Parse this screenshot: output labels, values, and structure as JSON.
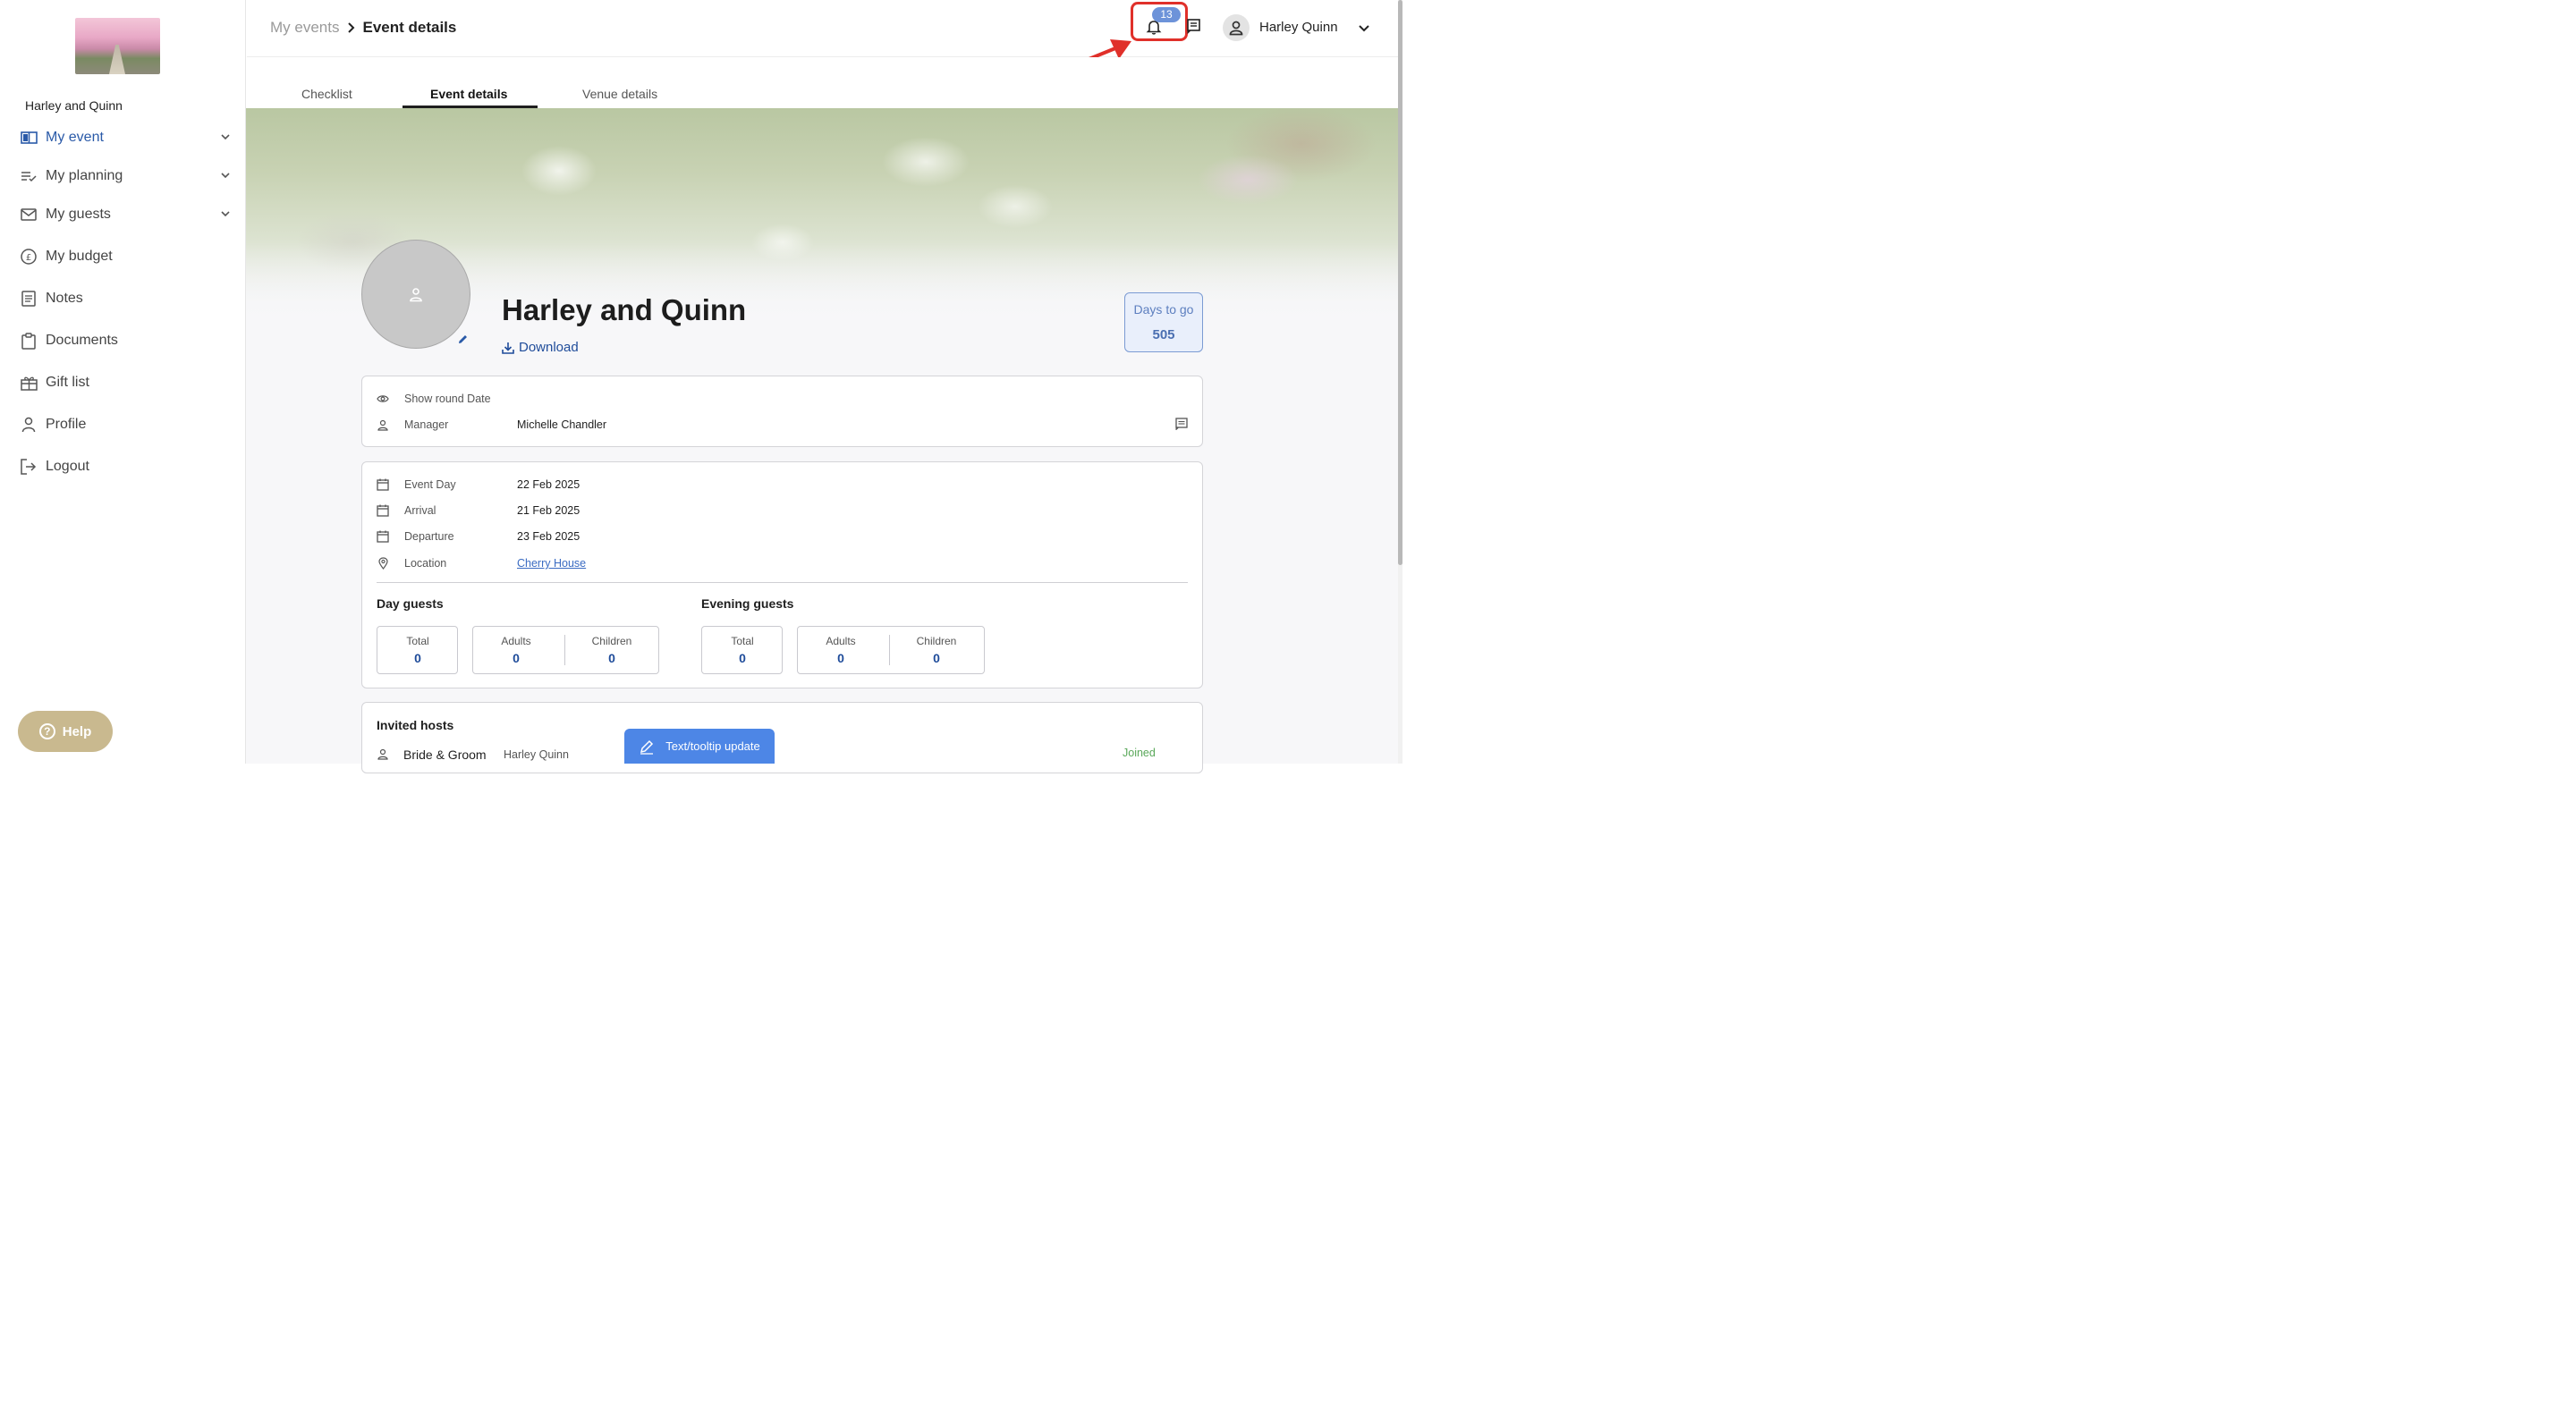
{
  "sidebar": {
    "event_name": "Harley and Quinn",
    "items": [
      {
        "label": "My event",
        "icon": "book-icon",
        "expandable": true,
        "active": true
      },
      {
        "label": "My planning",
        "icon": "checklist-icon",
        "expandable": true
      },
      {
        "label": "My guests",
        "icon": "mail-icon",
        "expandable": true
      },
      {
        "label": "My budget",
        "icon": "pound-icon"
      },
      {
        "label": "Notes",
        "icon": "notes-icon"
      },
      {
        "label": "Documents",
        "icon": "clipboard-icon"
      },
      {
        "label": "Gift list",
        "icon": "gift-icon"
      },
      {
        "label": "Profile",
        "icon": "person-icon"
      },
      {
        "label": "Logout",
        "icon": "logout-icon"
      }
    ],
    "help_label": "Help"
  },
  "header": {
    "breadcrumb": {
      "parent": "My events",
      "current": "Event details"
    },
    "notification_count": "13",
    "user_name": "Harley Quinn"
  },
  "tabs": [
    {
      "label": "Checklist"
    },
    {
      "label": "Event details",
      "active": true
    },
    {
      "label": "Venue details"
    }
  ],
  "event": {
    "title": "Harley and Quinn",
    "download_label": "Download",
    "days_to_go_label": "Days to go",
    "days_to_go_value": "505"
  },
  "info_card": {
    "show_round_label": "Show round Date",
    "manager_label": "Manager",
    "manager_value": "Michelle Chandler"
  },
  "details_card": {
    "event_day_label": "Event Day",
    "event_day_value": "22 Feb 2025",
    "arrival_label": "Arrival",
    "arrival_value": "21 Feb 2025",
    "departure_label": "Departure",
    "departure_value": "23 Feb 2025",
    "location_label": "Location",
    "location_value": "Cherry House",
    "day_guests": {
      "title": "Day guests",
      "total_label": "Total",
      "total": "0",
      "adults_label": "Adults",
      "adults": "0",
      "children_label": "Children",
      "children": "0"
    },
    "evening_guests": {
      "title": "Evening guests",
      "total_label": "Total",
      "total": "0",
      "adults_label": "Adults",
      "adults": "0",
      "children_label": "Children",
      "children": "0"
    }
  },
  "hosts_card": {
    "title": "Invited hosts",
    "role": "Bride & Groom",
    "name": "Harley Quinn",
    "status": "Joined"
  },
  "tooltip_button_label": "Text/tooltip update",
  "colors": {
    "accent": "#2a5aa8",
    "highlight": "#e0302a",
    "help": "#c9b98f",
    "joined": "#5aa85a"
  }
}
